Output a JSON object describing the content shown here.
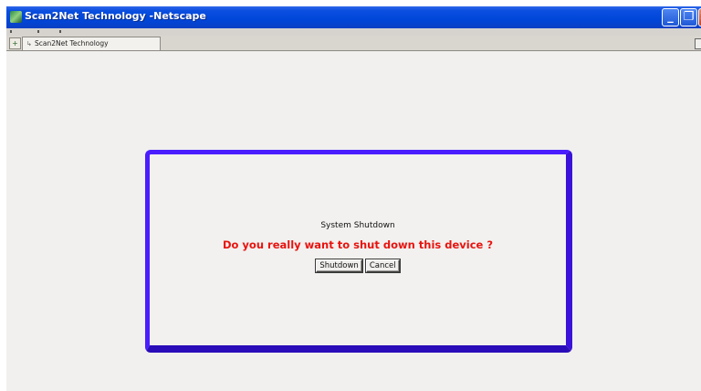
{
  "window": {
    "title": "Scan2Net Technology -Netscape",
    "controls": {
      "minimize_icon": "minimize-icon",
      "maximize_icon": "restore-icon",
      "close_icon": "close-icon"
    }
  },
  "tabs": [
    {
      "label": "Scan2Net Technology"
    }
  ],
  "dialog": {
    "title": "System Shutdown",
    "question": "Do you really want to shut down this device ?",
    "shutdown_label": "Shutdown",
    "cancel_label": "Cancel"
  },
  "colors": {
    "titlebar": "#0046d8",
    "dialog_border": "#4a1dff",
    "question_text": "#e8130f",
    "background": "#f1f0ee"
  }
}
